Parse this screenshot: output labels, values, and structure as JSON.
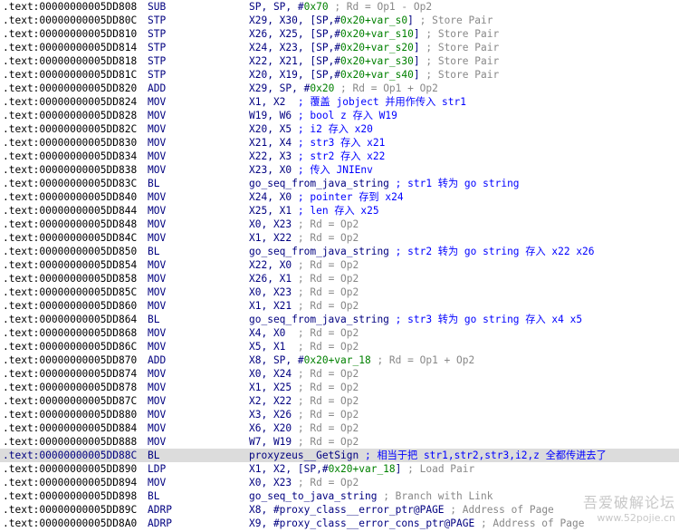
{
  "rows": [
    {
      "addr": ".text:00000000005DD808",
      "mn": "SUB",
      "ops": [
        {
          "t": "SP, SP, #"
        },
        {
          "t": "0x70",
          "g": 1
        },
        {
          "t": " ; Rd = Op1 - Op2",
          "c": 1
        }
      ]
    },
    {
      "addr": ".text:00000000005DD80C",
      "mn": "STP",
      "ops": [
        {
          "t": "X29, X30, [SP,#"
        },
        {
          "t": "0x20+var_s0",
          "g": 1
        },
        {
          "t": "] "
        },
        {
          "t": "; Store Pair",
          "c": 1
        }
      ]
    },
    {
      "addr": ".text:00000000005DD810",
      "mn": "STP",
      "ops": [
        {
          "t": "X26, X25, [SP,#"
        },
        {
          "t": "0x20+var_s10",
          "g": 1
        },
        {
          "t": "] "
        },
        {
          "t": "; Store Pair",
          "c": 1
        }
      ]
    },
    {
      "addr": ".text:00000000005DD814",
      "mn": "STP",
      "ops": [
        {
          "t": "X24, X23, [SP,#"
        },
        {
          "t": "0x20+var_s20",
          "g": 1
        },
        {
          "t": "] "
        },
        {
          "t": "; Store Pair",
          "c": 1
        }
      ]
    },
    {
      "addr": ".text:00000000005DD818",
      "mn": "STP",
      "ops": [
        {
          "t": "X22, X21, [SP,#"
        },
        {
          "t": "0x20+var_s30",
          "g": 1
        },
        {
          "t": "] "
        },
        {
          "t": "; Store Pair",
          "c": 1
        }
      ]
    },
    {
      "addr": ".text:00000000005DD81C",
      "mn": "STP",
      "ops": [
        {
          "t": "X20, X19, [SP,#"
        },
        {
          "t": "0x20+var_s40",
          "g": 1
        },
        {
          "t": "] "
        },
        {
          "t": "; Store Pair",
          "c": 1
        }
      ]
    },
    {
      "addr": ".text:00000000005DD820",
      "mn": "ADD",
      "ops": [
        {
          "t": "X29, SP, #"
        },
        {
          "t": "0x20",
          "g": 1
        },
        {
          "t": " ; Rd = Op1 + Op2",
          "c": 1
        }
      ]
    },
    {
      "addr": ".text:00000000005DD824",
      "mn": "MOV",
      "ops": [
        {
          "t": "X1, X2  "
        },
        {
          "t": "; 覆盖 jobject 并用作传入 str1",
          "cz": 1
        }
      ]
    },
    {
      "addr": ".text:00000000005DD828",
      "mn": "MOV",
      "ops": [
        {
          "t": "W19, W6 "
        },
        {
          "t": "; bool z 存入 W19",
          "cz": 1
        }
      ]
    },
    {
      "addr": ".text:00000000005DD82C",
      "mn": "MOV",
      "ops": [
        {
          "t": "X20, X5 "
        },
        {
          "t": "; i2 存入 x20",
          "cz": 1
        }
      ]
    },
    {
      "addr": ".text:00000000005DD830",
      "mn": "MOV",
      "ops": [
        {
          "t": "X21, X4 "
        },
        {
          "t": "; str3 存入 x21",
          "cz": 1
        }
      ]
    },
    {
      "addr": ".text:00000000005DD834",
      "mn": "MOV",
      "ops": [
        {
          "t": "X22, X3 "
        },
        {
          "t": "; str2 存入 x22",
          "cz": 1
        }
      ]
    },
    {
      "addr": ".text:00000000005DD838",
      "mn": "MOV",
      "ops": [
        {
          "t": "X23, X0 "
        },
        {
          "t": "; 传入 JNIEnv",
          "cz": 1
        }
      ]
    },
    {
      "addr": ".text:00000000005DD83C",
      "mn": "BL",
      "ops": [
        {
          "t": "go_seq_from_java_string "
        },
        {
          "t": "; str1 转为 go string",
          "cz": 1
        }
      ]
    },
    {
      "addr": ".text:00000000005DD840",
      "mn": "MOV",
      "ops": [
        {
          "t": "X24, X0 "
        },
        {
          "t": "; pointer 存到 x24",
          "cz": 1
        }
      ]
    },
    {
      "addr": ".text:00000000005DD844",
      "mn": "MOV",
      "ops": [
        {
          "t": "X25, X1 "
        },
        {
          "t": "; len 存入 x25",
          "cz": 1
        }
      ]
    },
    {
      "addr": ".text:00000000005DD848",
      "mn": "MOV",
      "ops": [
        {
          "t": "X0, X23 "
        },
        {
          "t": "; Rd = Op2",
          "c": 1
        }
      ]
    },
    {
      "addr": ".text:00000000005DD84C",
      "mn": "MOV",
      "ops": [
        {
          "t": "X1, X22 "
        },
        {
          "t": "; Rd = Op2",
          "c": 1
        }
      ]
    },
    {
      "addr": ".text:00000000005DD850",
      "mn": "BL",
      "ops": [
        {
          "t": "go_seq_from_java_string "
        },
        {
          "t": "; str2 转为 go string 存入 x22 x26",
          "cz": 1
        }
      ]
    },
    {
      "addr": ".text:00000000005DD854",
      "mn": "MOV",
      "ops": [
        {
          "t": "X22, X0 "
        },
        {
          "t": "; Rd = Op2",
          "c": 1
        }
      ]
    },
    {
      "addr": ".text:00000000005DD858",
      "mn": "MOV",
      "ops": [
        {
          "t": "X26, X1 "
        },
        {
          "t": "; Rd = Op2",
          "c": 1
        }
      ]
    },
    {
      "addr": ".text:00000000005DD85C",
      "mn": "MOV",
      "ops": [
        {
          "t": "X0, X23 "
        },
        {
          "t": "; Rd = Op2",
          "c": 1
        }
      ]
    },
    {
      "addr": ".text:00000000005DD860",
      "mn": "MOV",
      "ops": [
        {
          "t": "X1, X21 "
        },
        {
          "t": "; Rd = Op2",
          "c": 1
        }
      ]
    },
    {
      "addr": ".text:00000000005DD864",
      "mn": "BL",
      "ops": [
        {
          "t": "go_seq_from_java_string "
        },
        {
          "t": "; str3 转为 go string 存入 x4 x5",
          "cz": 1
        }
      ]
    },
    {
      "addr": ".text:00000000005DD868",
      "mn": "MOV",
      "ops": [
        {
          "t": "X4, X0  "
        },
        {
          "t": "; Rd = Op2",
          "c": 1
        }
      ]
    },
    {
      "addr": ".text:00000000005DD86C",
      "mn": "MOV",
      "ops": [
        {
          "t": "X5, X1  "
        },
        {
          "t": "; Rd = Op2",
          "c": 1
        }
      ]
    },
    {
      "addr": ".text:00000000005DD870",
      "mn": "ADD",
      "ops": [
        {
          "t": "X8, SP, #"
        },
        {
          "t": "0x20+var_18",
          "g": 1
        },
        {
          "t": " ; Rd = Op1 + Op2",
          "c": 1
        }
      ]
    },
    {
      "addr": ".text:00000000005DD874",
      "mn": "MOV",
      "ops": [
        {
          "t": "X0, X24 "
        },
        {
          "t": "; Rd = Op2",
          "c": 1
        }
      ]
    },
    {
      "addr": ".text:00000000005DD878",
      "mn": "MOV",
      "ops": [
        {
          "t": "X1, X25 "
        },
        {
          "t": "; Rd = Op2",
          "c": 1
        }
      ]
    },
    {
      "addr": ".text:00000000005DD87C",
      "mn": "MOV",
      "ops": [
        {
          "t": "X2, X22 "
        },
        {
          "t": "; Rd = Op2",
          "c": 1
        }
      ]
    },
    {
      "addr": ".text:00000000005DD880",
      "mn": "MOV",
      "ops": [
        {
          "t": "X3, X26 "
        },
        {
          "t": "; Rd = Op2",
          "c": 1
        }
      ]
    },
    {
      "addr": ".text:00000000005DD884",
      "mn": "MOV",
      "ops": [
        {
          "t": "X6, X20 "
        },
        {
          "t": "; Rd = Op2",
          "c": 1
        }
      ]
    },
    {
      "addr": ".text:00000000005DD888",
      "mn": "MOV",
      "ops": [
        {
          "t": "W7, W19 "
        },
        {
          "t": "; Rd = Op2",
          "c": 1
        }
      ]
    },
    {
      "addr": ".text:00000000005DD88C",
      "mn": "BL",
      "hl": true,
      "ops": [
        {
          "t": "proxyzeus__GetSign "
        },
        {
          "t": "; 相当于把 str1,str2,str3,i2,z 全都传进去了",
          "cz": 1
        }
      ]
    },
    {
      "addr": ".text:00000000005DD890",
      "mn": "LDP",
      "ops": [
        {
          "t": "X1, X2, [SP,#"
        },
        {
          "t": "0x20+var_18",
          "g": 1
        },
        {
          "t": "] "
        },
        {
          "t": "; Load Pair",
          "c": 1
        }
      ]
    },
    {
      "addr": ".text:00000000005DD894",
      "mn": "MOV",
      "ops": [
        {
          "t": "X0, X23 "
        },
        {
          "t": "; Rd = Op2",
          "c": 1
        }
      ]
    },
    {
      "addr": ".text:00000000005DD898",
      "mn": "BL",
      "ops": [
        {
          "t": "go_seq_to_java_string "
        },
        {
          "t": "; Branch with Link",
          "c": 1
        }
      ]
    },
    {
      "addr": ".text:00000000005DD89C",
      "mn": "ADRP",
      "ops": [
        {
          "t": "X8, #proxy_class__error_ptr@PAGE "
        },
        {
          "t": "; Address of Page",
          "c": 1
        }
      ]
    },
    {
      "addr": ".text:00000000005DD8A0",
      "mn": "ADRP",
      "ops": [
        {
          "t": "X9, #proxy_class__error_cons_ptr@PAGE "
        },
        {
          "t": "; Address of Page",
          "c": 1
        }
      ]
    }
  ],
  "watermark": {
    "title": "吾爱破解论坛",
    "url": "www.52pojie.cn"
  },
  "colors": {
    "text": "#000080",
    "address": "#000000",
    "comment": "#888888",
    "comment_note": "#0000ff",
    "operand_offset": "#008000",
    "highlight": "#dcdcdc"
  }
}
